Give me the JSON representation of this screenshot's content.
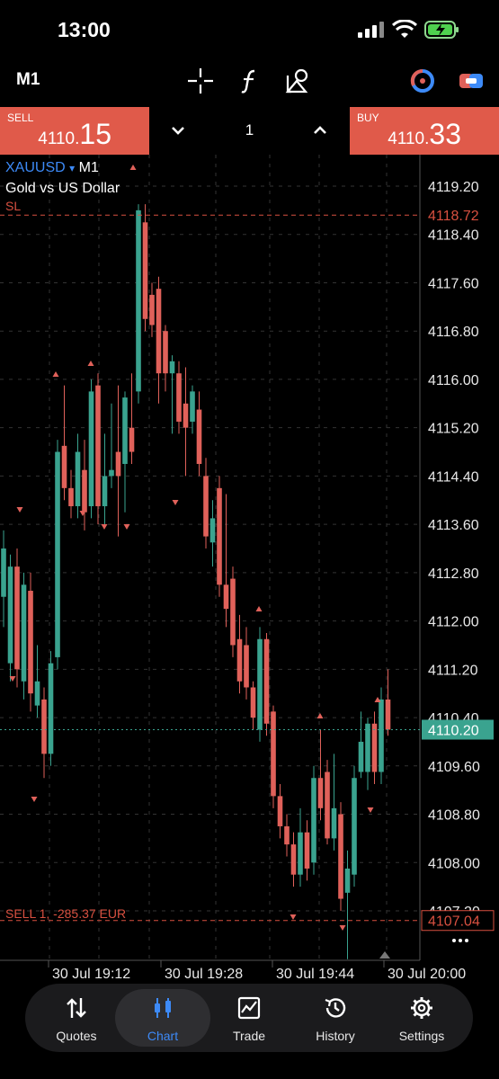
{
  "status": {
    "time": "13:00"
  },
  "toolbar": {
    "timeframe": "M1"
  },
  "trade": {
    "sell_label": "SELL",
    "sell_price_small": "4110.",
    "sell_price_big": "15",
    "buy_label": "BUY",
    "buy_price_small": "4110.",
    "buy_price_big": "33",
    "quantity": "1"
  },
  "symbol": {
    "ticker": "XAUUSD",
    "marker": "▾",
    "timeframe": "M1",
    "description": "Gold vs US Dollar",
    "sl_label": "SL"
  },
  "position": {
    "label": "SELL 1, -285.37 EUR"
  },
  "axis": {
    "ticks": [
      "4119.20",
      "4118.40",
      "4117.60",
      "4116.80",
      "4116.00",
      "4115.20",
      "4114.40",
      "4113.60",
      "4112.80",
      "4112.00",
      "4111.20",
      "4110.40",
      "4109.60",
      "4108.80",
      "4108.00",
      "4107.20"
    ],
    "sl_price": "4118.72",
    "current_price": "4110.20",
    "position_price": "4107.04",
    "time_labels": [
      "30 Jul 19:12",
      "30 Jul 19:28",
      "30 Jul 19:44",
      "30 Jul 20:00"
    ]
  },
  "colors": {
    "bull": "#3aa38f",
    "bear": "#e0615a",
    "accent": "#3d8af7",
    "trade": "#e05a4a",
    "current": "#3aa38f"
  },
  "tabs": [
    {
      "label": "Quotes",
      "icon": "quotes-arrows-icon"
    },
    {
      "label": "Chart",
      "icon": "candles-icon",
      "active": true
    },
    {
      "label": "Trade",
      "icon": "trade-chart-icon"
    },
    {
      "label": "History",
      "icon": "history-clock-icon"
    },
    {
      "label": "Settings",
      "icon": "gear-icon"
    }
  ]
}
